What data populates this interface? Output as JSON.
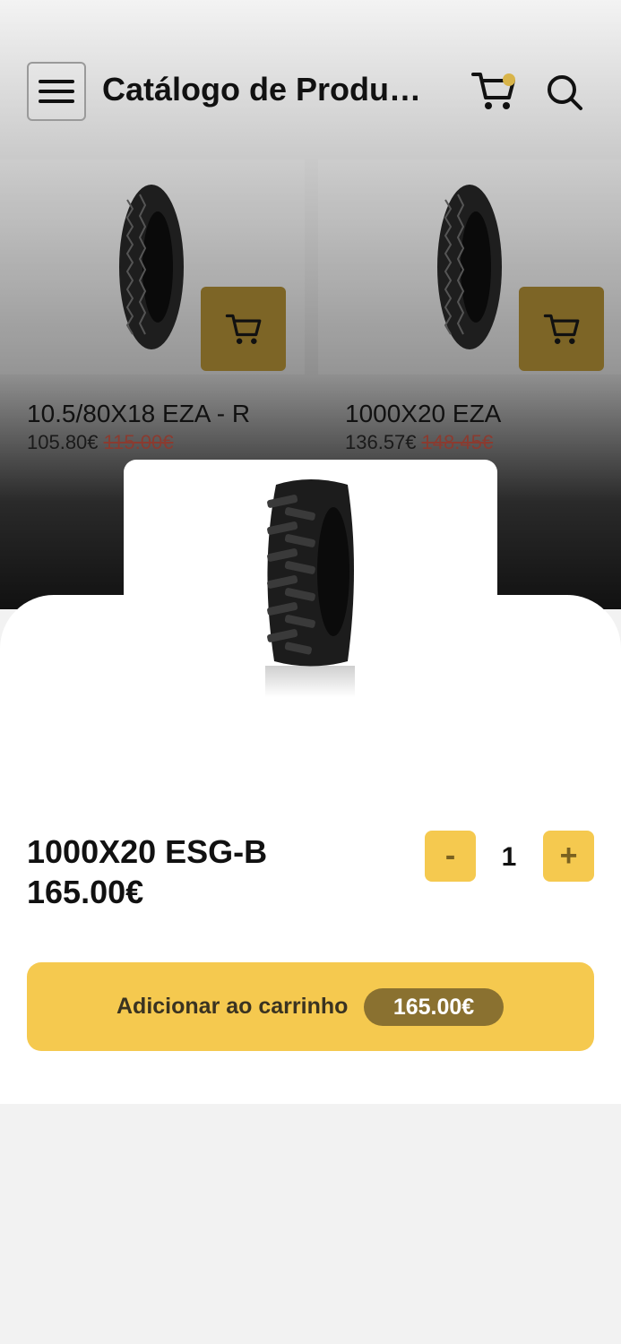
{
  "header": {
    "title": "Catálogo de Produtos",
    "menu_icon": "menu-icon",
    "cart_icon": "cart-icon",
    "search_icon": "search-icon",
    "cart_badge_color": "#d8b44a"
  },
  "products": [
    {
      "name": "10.5/80X18 EZA - R",
      "price": "105.80€",
      "old_price": "115.00€"
    },
    {
      "name": "1000X20 EZA",
      "price": "136.57€",
      "old_price": "148.45€"
    }
  ],
  "sheet": {
    "product_name": "1000X20 ESG-B",
    "product_price": "165.00€",
    "qty_minus": "-",
    "qty_plus": "+",
    "quantity": "1",
    "add_label": "Adicionar ao carrinho",
    "add_price": "165.00€"
  },
  "colors": {
    "accent": "#f5c94f",
    "accent_dark": "#8a7130",
    "old_price": "#8a3b30"
  }
}
